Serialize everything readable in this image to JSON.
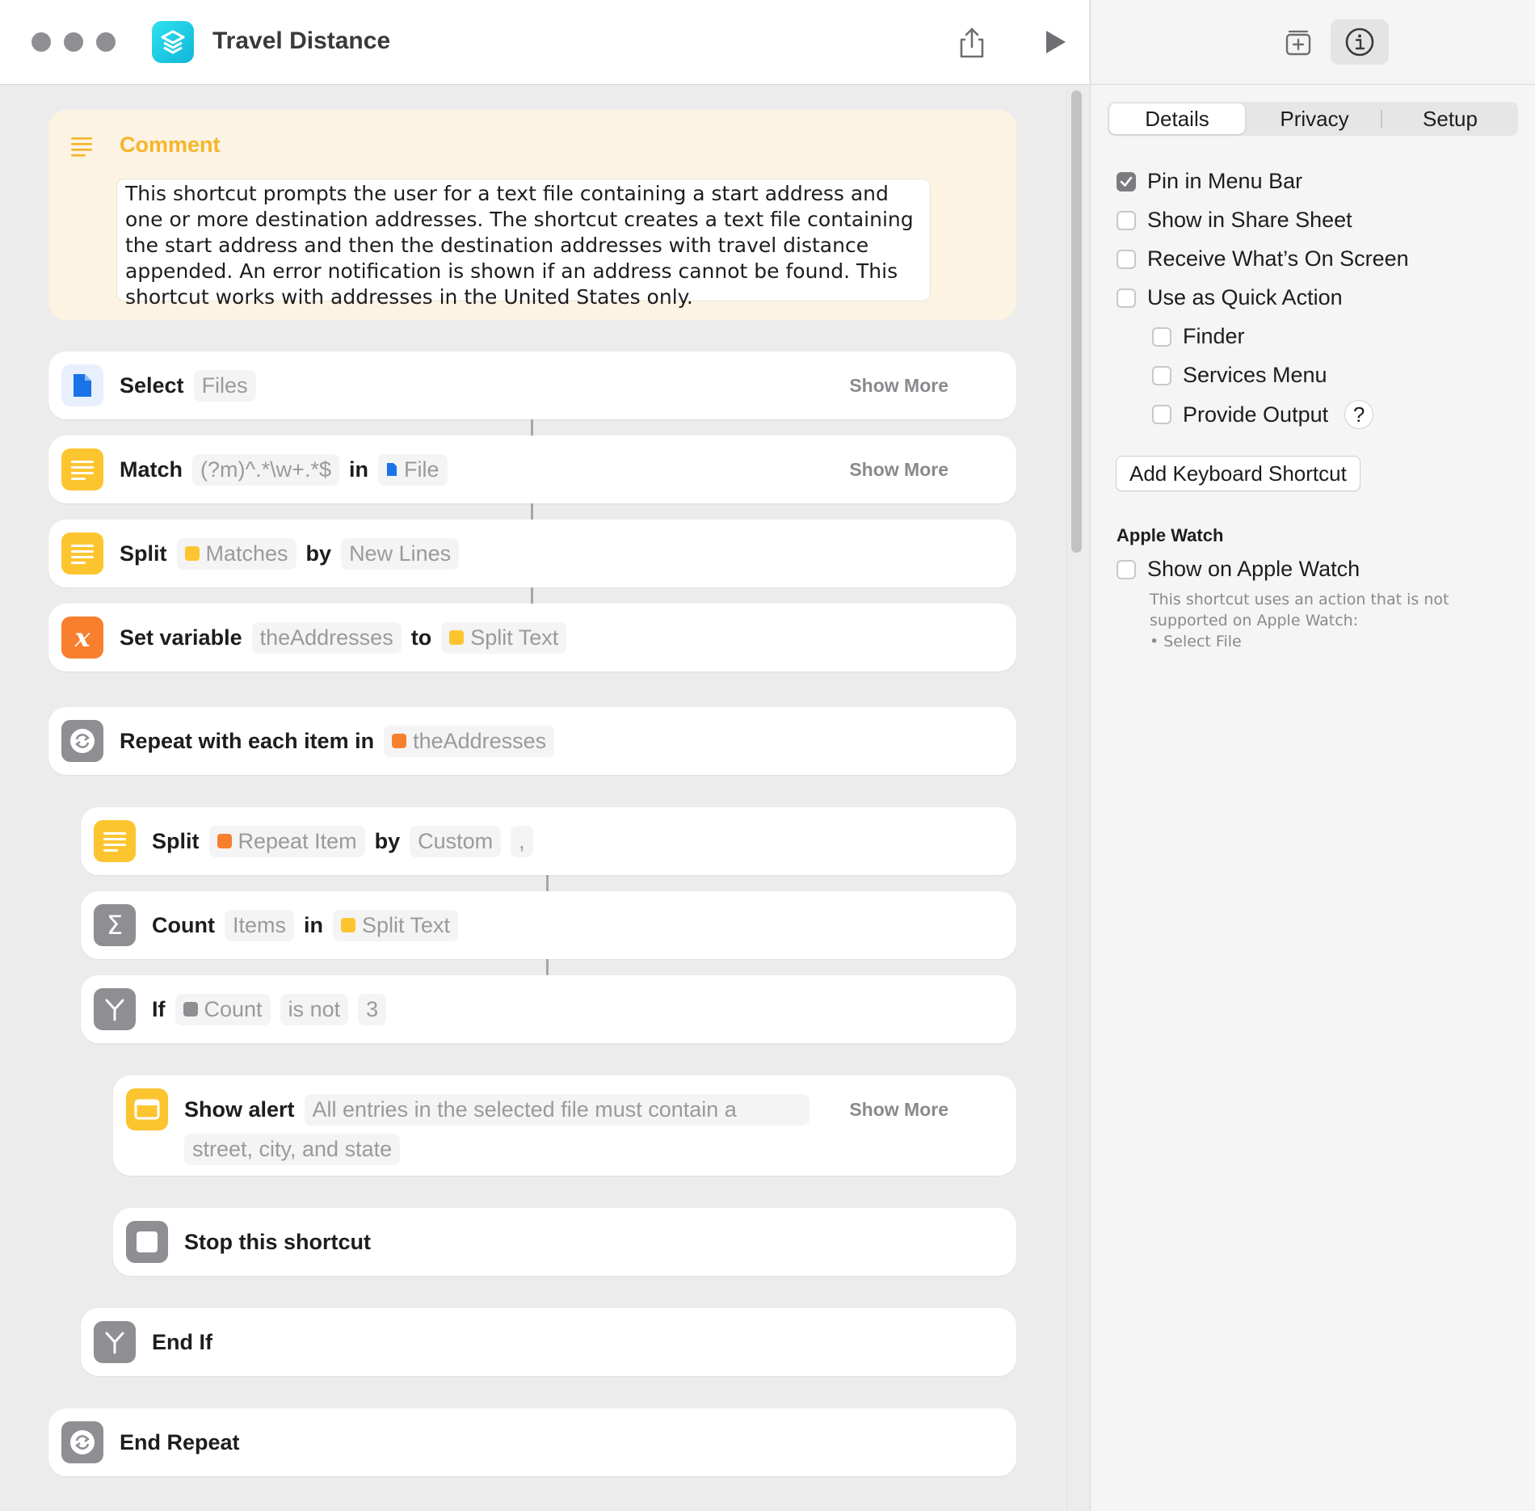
{
  "window": {
    "title": "Travel Distance",
    "accent": "#1abfe0"
  },
  "comment": {
    "title": "Comment",
    "body": "This shortcut prompts the user for a text file containing a start address and one or more destination addresses. The shortcut creates a text file containing the start address and then the destination addresses with travel distance appended. An error notification is shown if an address cannot be found. This shortcut works with addresses in the United States only."
  },
  "actions": {
    "select": {
      "verb": "Select",
      "param": "Files",
      "show_more": "Show More"
    },
    "match": {
      "verb": "Match",
      "pattern": "(?m)^.*\\w+.*$",
      "in": "in",
      "source": "File",
      "show_more": "Show More"
    },
    "split1": {
      "verb": "Split",
      "input": "Matches",
      "by": "by",
      "separator": "New Lines"
    },
    "setvar": {
      "verb": "Set variable",
      "name": "theAddresses",
      "to": "to",
      "value": "Split Text"
    },
    "repeat": {
      "verb": "Repeat with each item in",
      "source": "theAddresses"
    },
    "split2": {
      "verb": "Split",
      "input": "Repeat Item",
      "by": "by",
      "separator": "Custom",
      "custom": ","
    },
    "count": {
      "verb": "Count",
      "what": "Items",
      "in": "in",
      "source": "Split Text"
    },
    "if": {
      "verb": "If",
      "input": "Count",
      "condition": "is not",
      "value": "3"
    },
    "alert": {
      "verb": "Show alert",
      "message_line1": "All entries in the selected file must contain a",
      "message_line2": "street, city, and state",
      "show_more": "Show More"
    },
    "stop": {
      "verb": "Stop this shortcut"
    },
    "endif": {
      "verb": "End If"
    },
    "endrepeat": {
      "verb": "End Repeat"
    }
  },
  "inspector": {
    "tabs": [
      "Details",
      "Privacy",
      "Setup"
    ],
    "selected_tab": "Details",
    "options": [
      {
        "label": "Pin in Menu Bar",
        "checked": true
      },
      {
        "label": "Show in Share Sheet",
        "checked": false
      },
      {
        "label": "Receive What’s On Screen",
        "checked": false
      },
      {
        "label": "Use as Quick Action",
        "checked": false
      },
      {
        "label": "Finder",
        "checked": false
      },
      {
        "label": "Services Menu",
        "checked": false
      },
      {
        "label": "Provide Output",
        "checked": false
      }
    ],
    "help_glyph": "?",
    "add_shortcut_button": "Add Keyboard Shortcut",
    "watch_section": "Apple Watch",
    "watch_option": {
      "label": "Show on Apple Watch",
      "checked": false
    },
    "watch_note_1": "This shortcut uses an action that is not",
    "watch_note_2": "supported on Apple Watch:",
    "watch_note_3": "• Select File"
  }
}
